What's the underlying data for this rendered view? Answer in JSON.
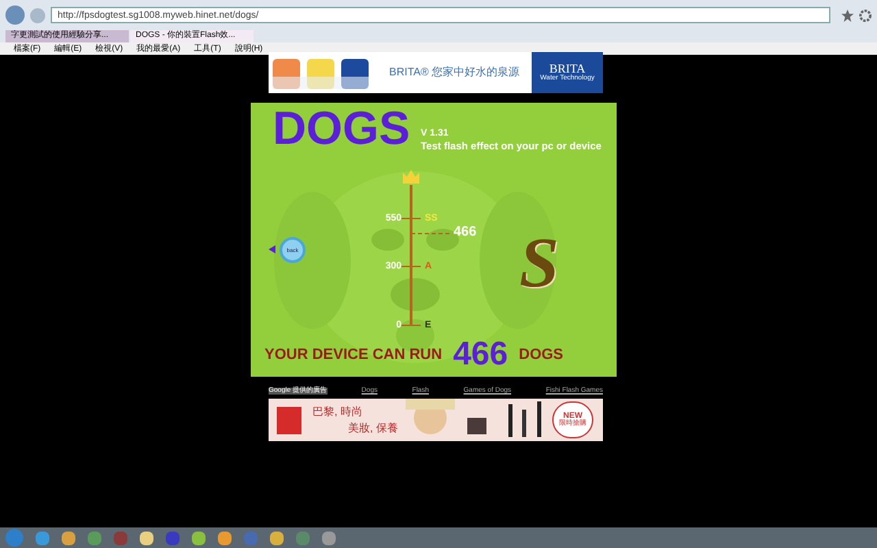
{
  "browser": {
    "url": "http://fpsdogtest.sg1008.myweb.hinet.net/dogs/",
    "tabs": [
      {
        "label": "字更測試的使用經驗分享...",
        "selected": false
      },
      {
        "label": "DOGS - 你的裝置Flash效...",
        "selected": true
      }
    ],
    "menu": [
      "檔案(F)",
      "編輯(E)",
      "檢視(V)",
      "我的最愛(A)",
      "工具(T)",
      "說明(H)"
    ]
  },
  "top_ad": {
    "slogan": "BRITA® 您家中好水的泉源",
    "brand": "BRITA",
    "tagline": "Water Technology"
  },
  "app": {
    "title": "DOGS",
    "version": "V 1.31",
    "subtitle": "Test flash effect on your pc or device",
    "scale": [
      {
        "value": "550",
        "grade": "SS",
        "color": "#f5e642"
      },
      {
        "value": "300",
        "grade": "A",
        "color": "#e0561a"
      },
      {
        "value": "0",
        "grade": "E",
        "color": "#333333"
      }
    ],
    "marker": "466",
    "level": 0.66,
    "grade": "S",
    "back": "back",
    "result": {
      "prefix": "YOUR DEVICE CAN RUN",
      "count": "466",
      "suffix": "DOGS"
    }
  },
  "ad_links": [
    "Google 提供的廣告",
    "Dogs",
    "Flash",
    "Games of Dogs",
    "Fishi Flash Games"
  ],
  "bottom_ad": {
    "line_1": "巴黎, 時尚",
    "line_2": "美妝, 保養",
    "badge_1": "NEW",
    "badge_2": "限時搶購"
  }
}
